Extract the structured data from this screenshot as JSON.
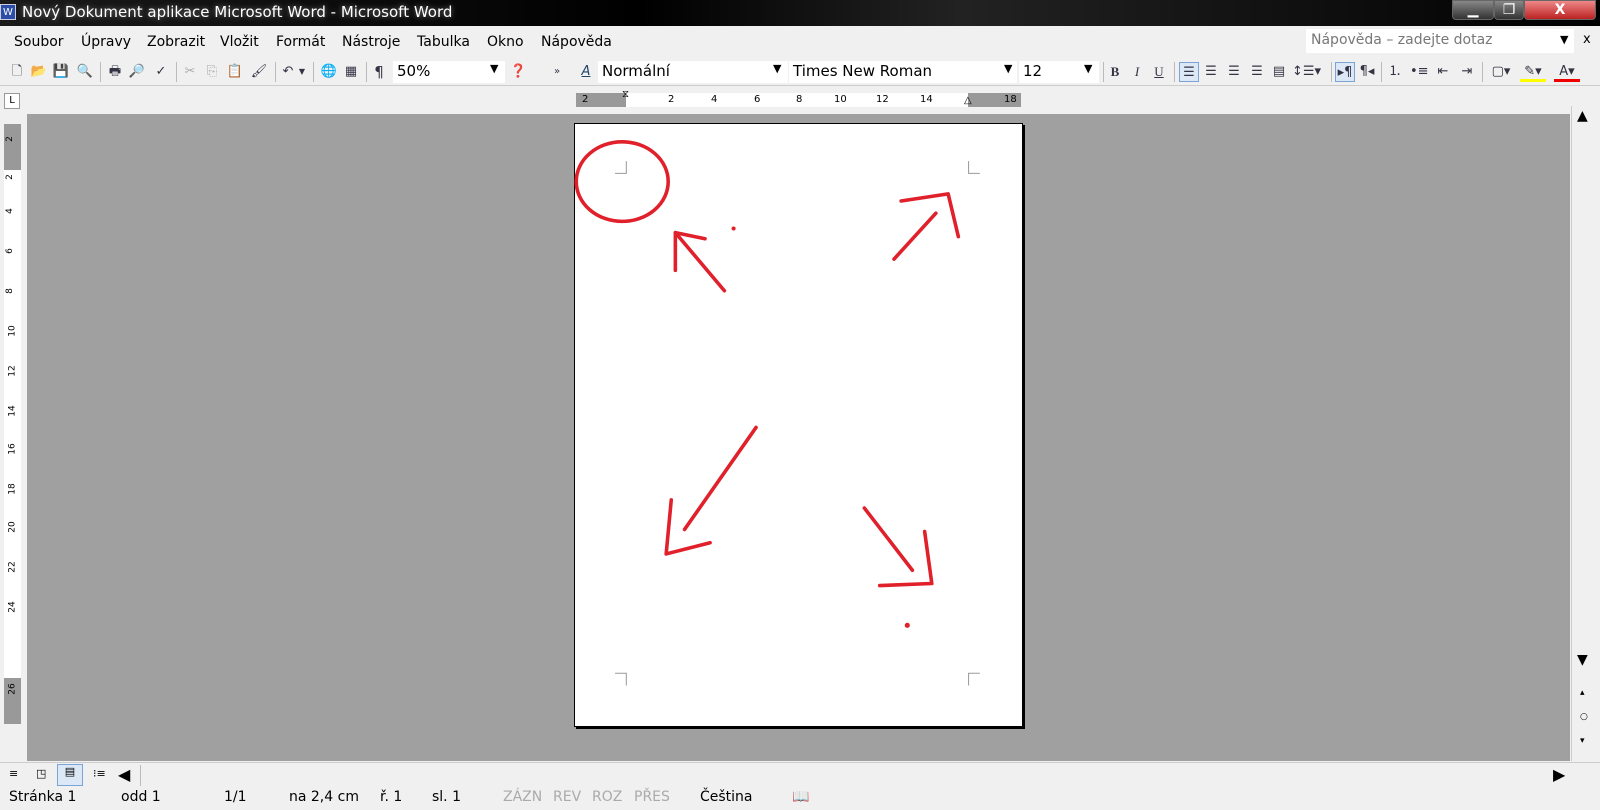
{
  "window": {
    "title": "Nový Dokument aplikace Microsoft Word - Microsoft Word",
    "app_icon": "W"
  },
  "menu": [
    "Soubor",
    "Úpravy",
    "Zobrazit",
    "Vložit",
    "Formát",
    "Nástroje",
    "Tabulka",
    "Okno",
    "Nápověda"
  ],
  "help": {
    "placeholder": "Nápověda – zadejte dotaz",
    "close": "x"
  },
  "toolbar": {
    "zoom": "50%",
    "style": "Normální",
    "font": "Times New Roman",
    "size": "12",
    "bold": "B",
    "italic": "I",
    "underline": "U",
    "pilcrow": "¶"
  },
  "ruler": {
    "h_labels": [
      "2",
      "2",
      "4",
      "6",
      "8",
      "10",
      "12",
      "14",
      "18"
    ],
    "v_labels": [
      "2",
      "2",
      "4",
      "6",
      "8",
      "10",
      "12",
      "14",
      "16",
      "18",
      "20",
      "22",
      "24",
      "26"
    ],
    "tab_selector": "L"
  },
  "status": {
    "page": "Stránka 1",
    "section": "odd 1",
    "pages": "1/1",
    "position": "na 2,4 cm",
    "line": "ř. 1",
    "column": "sl. 1",
    "rec": "ZÁZN",
    "trk": "REV",
    "ext": "ROZ",
    "ovr": "PŘES",
    "language": "Čeština"
  },
  "colors": {
    "ink": "#e0202a",
    "workspace": "#a0a0a0"
  }
}
